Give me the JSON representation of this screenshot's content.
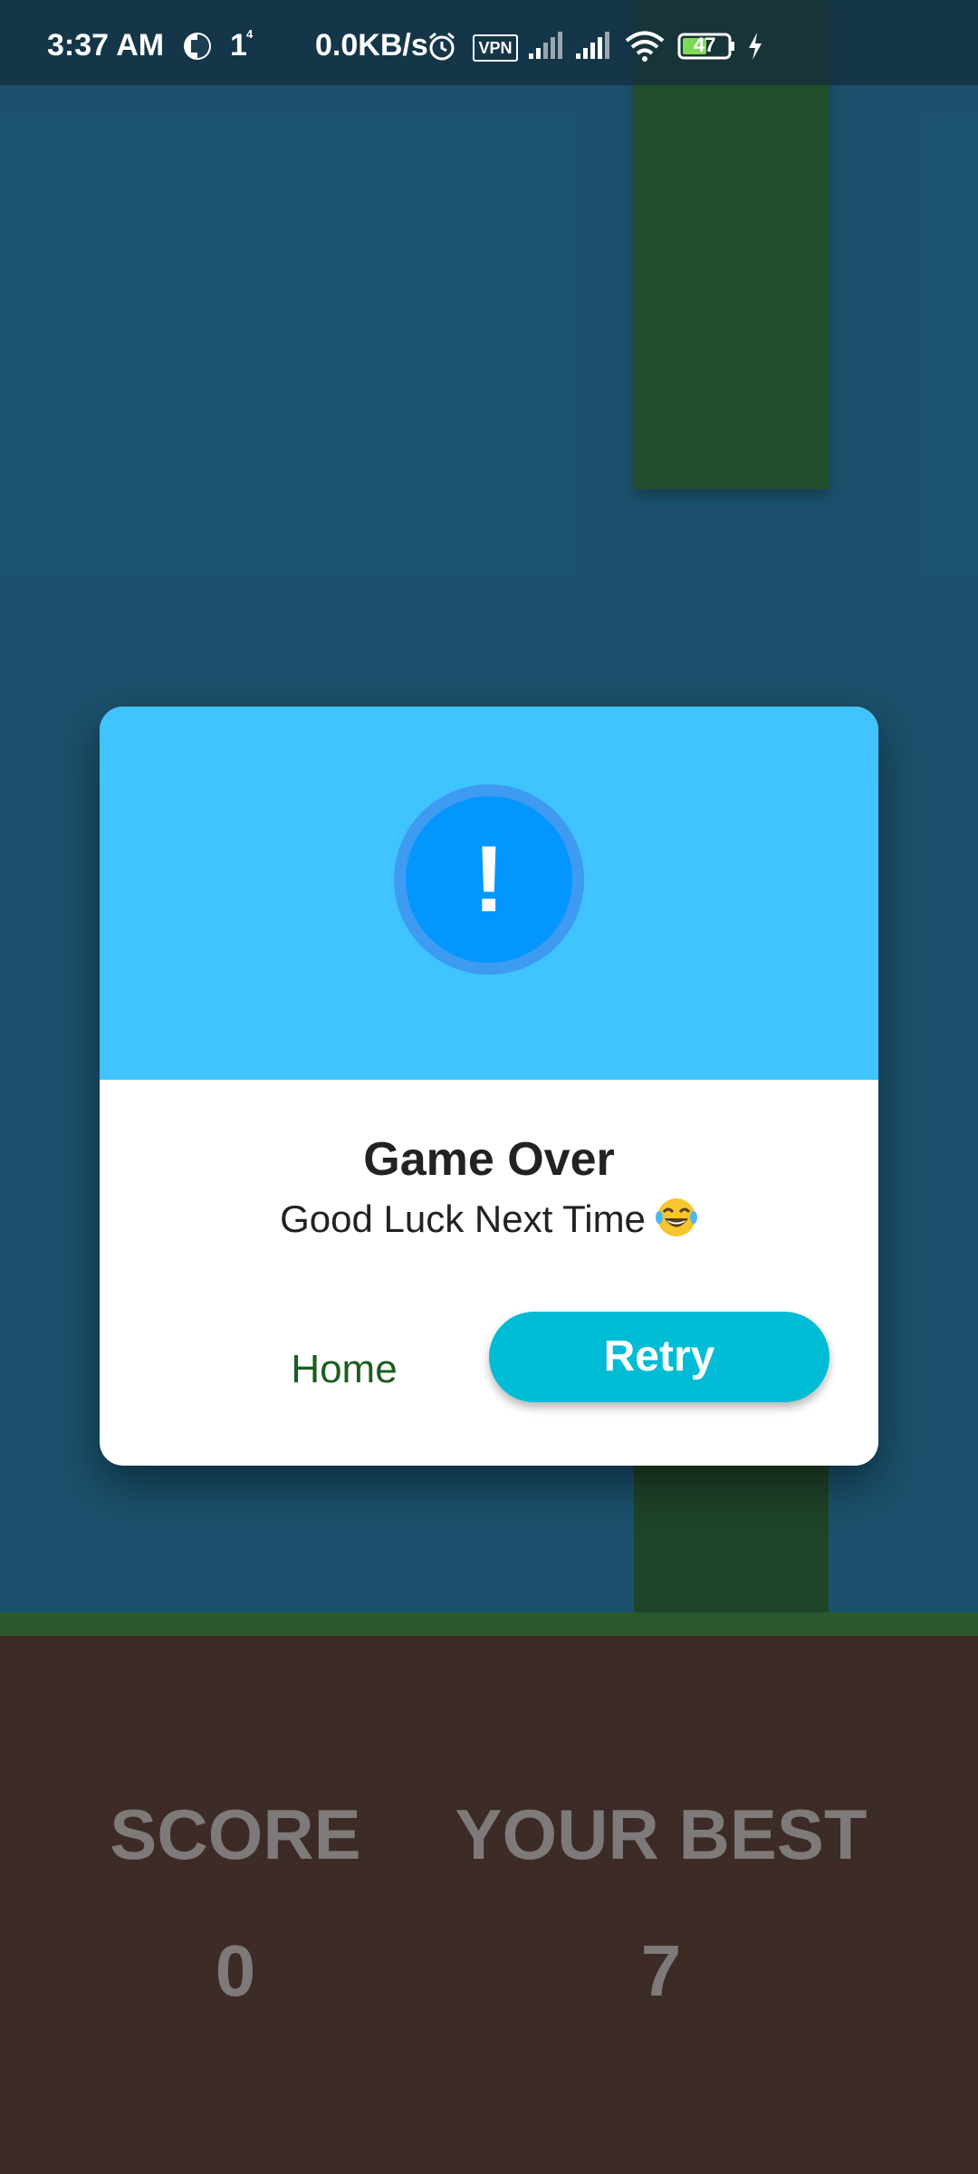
{
  "status_bar": {
    "time": "3:37 AM",
    "notification_count": "1",
    "speed": "0.0KB/s",
    "vpn_label": "VPN",
    "battery": "47",
    "icons": [
      "app-notification-icon",
      "alarm-icon",
      "vpn-icon",
      "signal-icon",
      "signal-icon",
      "wifi-icon",
      "battery-icon",
      "charging-icon"
    ]
  },
  "dialog": {
    "icon": "!",
    "title": "Game Over",
    "message": "Good Luck Next Time",
    "emoji_icon": "laughing-tears-emoji-icon",
    "home_label": "Home",
    "retry_label": "Retry"
  },
  "scoreboard": {
    "score_label": "SCORE",
    "score_value": "0",
    "best_label": "YOUR BEST",
    "best_value": "7"
  },
  "colors": {
    "sky": "#1f5d7b",
    "pipe": "#285a2d",
    "ground": "#3c2b26",
    "dialog_header": "#40c4ff",
    "retry_button": "#00bcd4",
    "home_text": "#1b5e20"
  }
}
